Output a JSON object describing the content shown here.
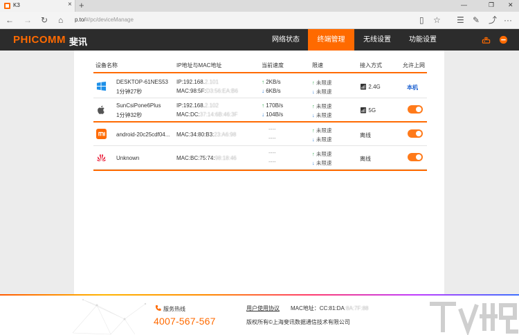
{
  "browser": {
    "tab_title": "K3",
    "tab_close": "×",
    "new_tab": "+",
    "url_host": "p.to/",
    "url_path": "#/pc/deviceManage",
    "win_min": "—",
    "win_max": "❐",
    "win_close": "✕",
    "nav_back": "←",
    "nav_forward": "→",
    "nav_refresh": "↻",
    "nav_home": "⌂",
    "reading_view": "▯",
    "favorite": "☆",
    "hub": "☰",
    "notes": "✎",
    "share": "⤴",
    "more": "···"
  },
  "header": {
    "logo": "PHICOMM",
    "logo_cn": "斐讯",
    "nav": [
      {
        "label": "网络状态",
        "active": false
      },
      {
        "label": "终端管理",
        "active": true
      },
      {
        "label": "无线设置",
        "active": false
      },
      {
        "label": "功能设置",
        "active": false
      }
    ]
  },
  "table": {
    "headers": [
      "设备名称",
      "IP地址与MAC地址",
      "当前速度",
      "限速",
      "接入方式",
      "允许上网"
    ],
    "rows": [
      {
        "os": "windows",
        "name": "DESKTOP-61NES53",
        "time": "1分钟27秒",
        "ip": "IP:192.168.",
        "ip_hidden": "2.101",
        "mac": "MAC:98:5F:",
        "mac_hidden": "D3:56:EA:B6",
        "up": "2KB/s",
        "down": "6KB/s",
        "limit_up": "未限速",
        "limit_down": "未限速",
        "conn": "2.4G",
        "allow": "本机"
      },
      {
        "os": "apple",
        "name": "SunCsiPone6Plus",
        "time": "1分钟32秒",
        "ip": "IP:192.168.",
        "ip_hidden": "2.102",
        "mac": "MAC:DC:",
        "mac_hidden": "37:14:6B:46:3F",
        "up": "170B/s",
        "down": "104B/s",
        "limit_up": "未限速",
        "limit_down": "未限速",
        "conn": "5G",
        "allow": "toggle-on"
      },
      {
        "os": "xiaomi",
        "name": "android-20c25cdf04...",
        "mac": "MAC:34:80:B3:",
        "mac_hidden": "23:A6:98",
        "up": "----",
        "down": "----",
        "limit_up": "未限速",
        "limit_down": "未限速",
        "conn": "离线",
        "allow": "toggle-on"
      },
      {
        "os": "huawei",
        "name": "Unknown",
        "mac": "MAC:BC:75:74:",
        "mac_hidden": "98:18:46",
        "up": "----",
        "down": "----",
        "limit_up": "未限速",
        "limit_down": "未限速",
        "conn": "离线",
        "allow": "toggle-on"
      }
    ]
  },
  "footer": {
    "hotline_label": "服务热线",
    "hotline_number": "4007-567-567",
    "user_agreement": "用户使用协议",
    "mac_label": "MAC地址：CC:81:DA",
    "mac_hidden": ":8A:7F:88",
    "copyright": "版权所有©上海斐讯数据通信技术有限公司"
  },
  "colors": {
    "accent": "#ff6a00",
    "header_bg": "#2c2c2c",
    "arrow_up": "#2fa84f",
    "arrow_down": "#2b7bd6",
    "self_text": "#1a5fd0"
  }
}
